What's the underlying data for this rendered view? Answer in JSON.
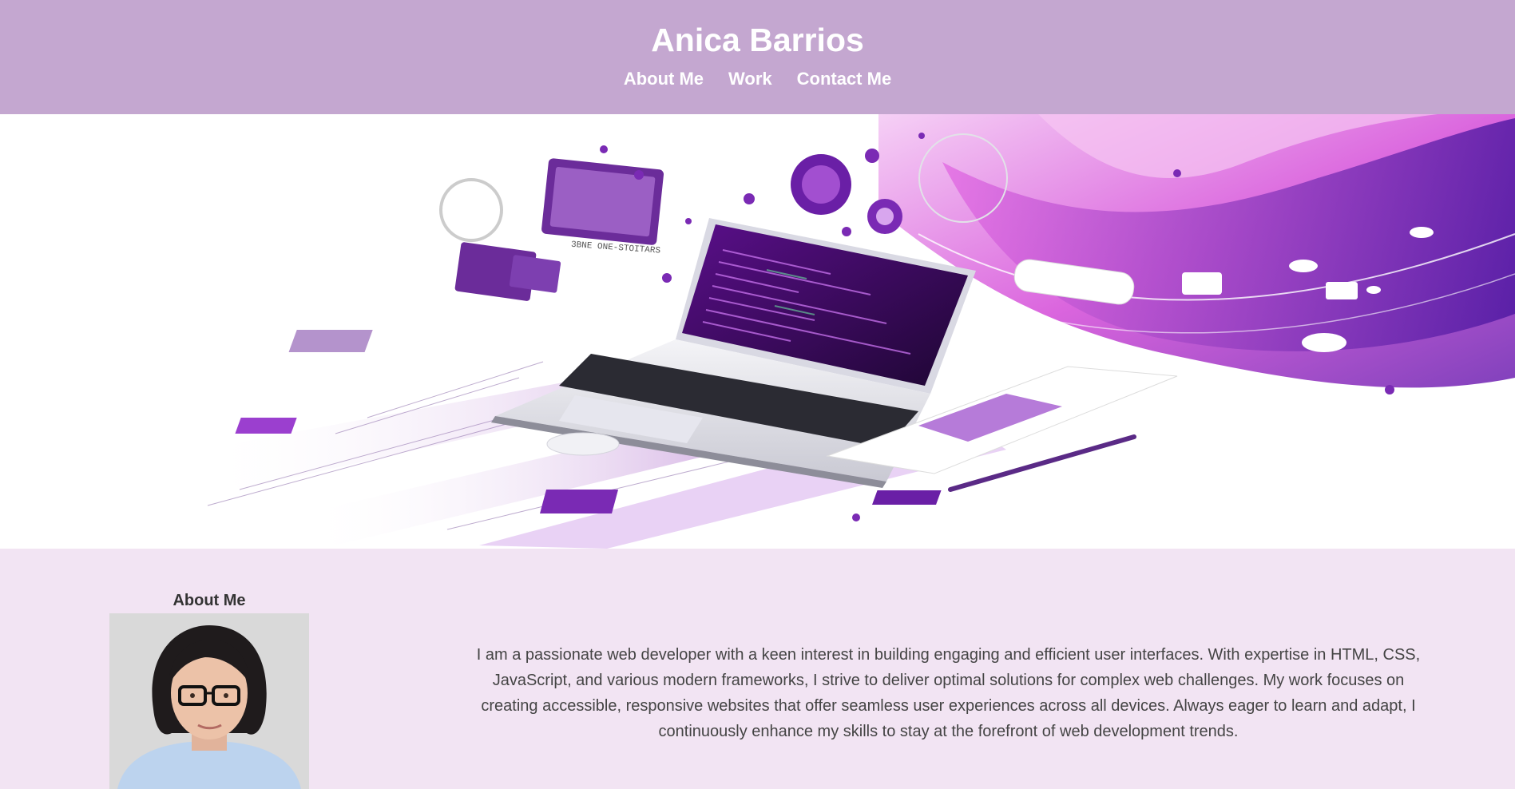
{
  "header": {
    "title": "Anica Barrios",
    "nav": [
      {
        "label": "About Me"
      },
      {
        "label": "Work"
      },
      {
        "label": "Contact Me"
      }
    ]
  },
  "hero": {
    "image": "laptop-code-illustration",
    "caption_glyphs": "3BNE ONE-STOITARS"
  },
  "about": {
    "heading": "About Me",
    "photo": "portrait-photo",
    "bio": "I am a passionate web developer with a keen interest in building engaging and efficient user interfaces. With expertise in HTML, CSS, JavaScript, and various modern frameworks, I strive to deliver optimal solutions for complex web challenges. My work focuses on creating accessible, responsive websites that offer seamless user experiences across all devices. Always eager to learn and adapt, I continuously enhance my skills to stay at the forefront of web development trends."
  },
  "colors": {
    "header_bg": "#c4a7d0",
    "section_bg": "#f2e4f3",
    "accent": "#8a2bb5",
    "text": "#444444"
  }
}
